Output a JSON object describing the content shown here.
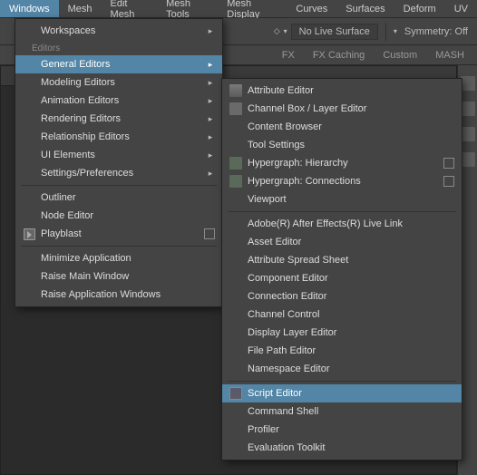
{
  "menubar": {
    "items": [
      {
        "label": "Windows",
        "active": true
      },
      {
        "label": "Mesh"
      },
      {
        "label": "Edit Mesh"
      },
      {
        "label": "Mesh Tools"
      },
      {
        "label": "Mesh Display"
      },
      {
        "label": "Curves"
      },
      {
        "label": "Surfaces"
      },
      {
        "label": "Deform"
      },
      {
        "label": "UV"
      }
    ]
  },
  "toolbar": {
    "no_live_surface": "No Live Surface",
    "symmetry": "Symmetry: Off"
  },
  "shelf": {
    "tabs": [
      {
        "label": "FX"
      },
      {
        "label": "FX Caching"
      },
      {
        "label": "Custom"
      },
      {
        "label": "MASH"
      }
    ]
  },
  "windows_menu": {
    "headers": {
      "workspaces": "Workspaces",
      "editors": "Editors"
    },
    "editor_groups": [
      {
        "label": "General Editors",
        "highlight": true,
        "arrow": true
      },
      {
        "label": "Modeling Editors",
        "arrow": true
      },
      {
        "label": "Animation Editors",
        "arrow": true
      },
      {
        "label": "Rendering Editors",
        "arrow": true
      },
      {
        "label": "Relationship Editors",
        "arrow": true
      },
      {
        "label": "UI Elements",
        "arrow": true
      },
      {
        "label": "Settings/Preferences",
        "arrow": true
      }
    ],
    "mid_items": [
      {
        "label": "Outliner"
      },
      {
        "label": "Node Editor"
      },
      {
        "label": "Playblast",
        "icon": "play",
        "option_box": true
      }
    ],
    "bottom_items": [
      {
        "label": "Minimize Application"
      },
      {
        "label": "Raise Main Window"
      },
      {
        "label": "Raise Application Windows"
      }
    ]
  },
  "general_editors_submenu": {
    "items": [
      {
        "label": "Attribute Editor",
        "icon": "attr"
      },
      {
        "label": "Channel Box / Layer Editor",
        "icon": "chan"
      },
      {
        "label": "Content Browser"
      },
      {
        "label": "Tool Settings"
      },
      {
        "label": "Hypergraph: Hierarchy",
        "icon": "hgraph",
        "option_box": true
      },
      {
        "label": "Hypergraph: Connections",
        "icon": "hgraph",
        "option_box": true
      },
      {
        "label": "Viewport"
      },
      {
        "sep": true
      },
      {
        "label": "Adobe(R) After Effects(R) Live Link"
      },
      {
        "label": "Asset Editor"
      },
      {
        "label": "Attribute Spread Sheet"
      },
      {
        "label": "Component Editor"
      },
      {
        "label": "Connection Editor"
      },
      {
        "label": "Channel Control"
      },
      {
        "label": "Display Layer Editor"
      },
      {
        "label": "File Path Editor"
      },
      {
        "label": "Namespace Editor"
      },
      {
        "sep": true
      },
      {
        "label": "Script Editor",
        "icon": "script",
        "highlight": true
      },
      {
        "label": "Command Shell"
      },
      {
        "label": "Profiler"
      },
      {
        "label": "Evaluation Toolkit"
      }
    ]
  }
}
